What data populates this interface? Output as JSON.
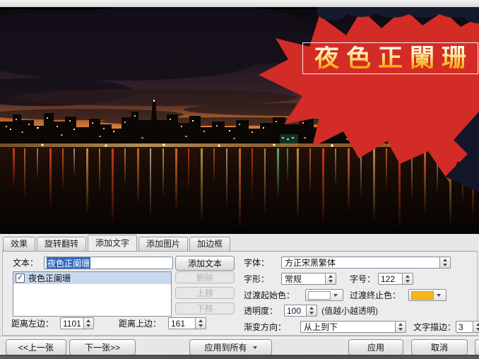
{
  "preview": {
    "overlay_text": "夜色正闌珊",
    "splash_color": "#d32b26",
    "overlay_gradient_start": "#ffffff",
    "overlay_gradient_end": "#f7a413"
  },
  "tabs": [
    {
      "label": "效果"
    },
    {
      "label": "旋转翻转"
    },
    {
      "label": "添加文字"
    },
    {
      "label": "添加图片"
    },
    {
      "label": "加边框"
    }
  ],
  "text_panel": {
    "text_label": "文本：",
    "text_value": "夜色正阑珊",
    "add_text_button": "添加文本",
    "list_items": [
      {
        "label": "夜色正阑珊",
        "checked": true
      }
    ],
    "delete_button": "删除",
    "move_up_button": "上移",
    "move_down_button": "下移",
    "distance_left_label": "距离左边：",
    "distance_left_value": "1101",
    "distance_top_label": "距离上边：",
    "distance_top_value": "161"
  },
  "font_panel": {
    "font_label": "字体：",
    "font_value": "方正宋黑繁体",
    "style_label": "字形：",
    "style_value": "常规",
    "size_label": "字号：",
    "size_value": "122",
    "grad_start_label": "过渡起始色：",
    "grad_start_color": "#ffffff",
    "grad_end_label": "过渡终止色：",
    "grad_end_color": "#f5b715",
    "opacity_label": "透明度：",
    "opacity_value": "100",
    "opacity_hint": "(值越小越透明)",
    "grad_dir_label": "渐变方向：",
    "grad_dir_value": "从上到下",
    "stroke_label": "文字描边：",
    "stroke_value": "3"
  },
  "footer": {
    "prev_button": "<<上一张",
    "next_button": "下一张>>",
    "apply_all_button": "应用到所有",
    "apply_button": "应用",
    "cancel_button": "取消"
  }
}
